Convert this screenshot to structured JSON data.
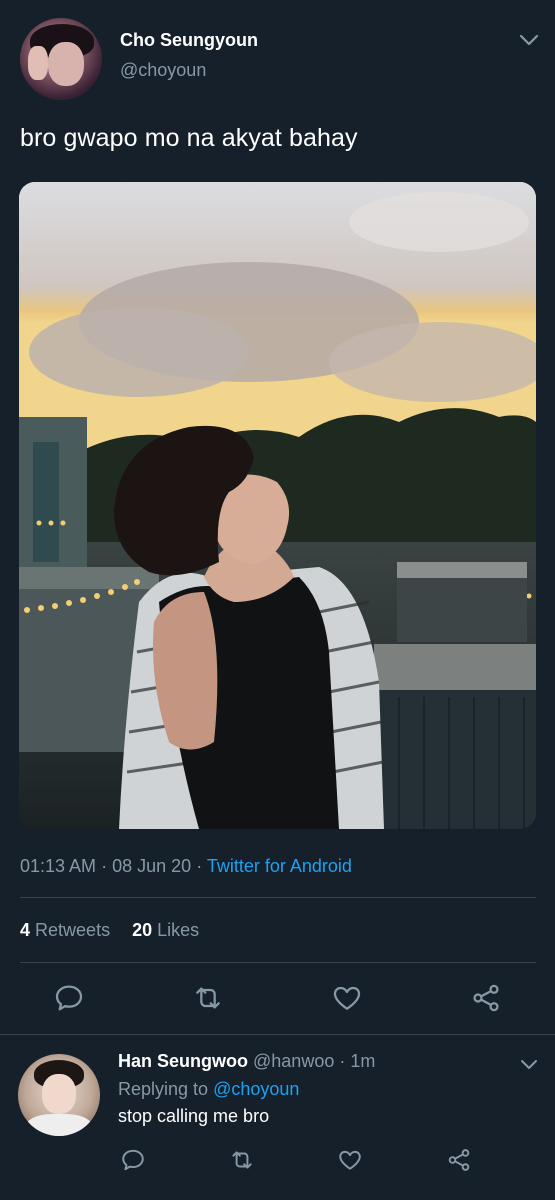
{
  "tweet": {
    "author_name": "Cho Seungyoun",
    "author_handle": "@choyoun",
    "text": "bro gwapo mo na akyat bahay",
    "time": "01:13 AM",
    "date": "08 Jun 20",
    "separator": "·",
    "source": "Twitter for Android",
    "retweets_count": "4",
    "retweets_label": "Retweets",
    "likes_count": "20",
    "likes_label": "Likes",
    "actions": [
      "reply-icon",
      "retweet-icon",
      "like-icon",
      "share-icon"
    ]
  },
  "reply": {
    "author_name": "Han Seungwoo",
    "author_handle": "@hanwoo",
    "age": "· 1m",
    "replying_to_label": "Replying to",
    "replying_to_handle": "@choyoun",
    "text": "stop calling me bro",
    "actions": [
      "reply-icon",
      "retweet-icon",
      "like-icon",
      "share-icon"
    ]
  },
  "colors": {
    "background": "#15202b",
    "accent": "#1da1f2",
    "secondary_text": "#8899a6",
    "divider": "#38444d"
  }
}
